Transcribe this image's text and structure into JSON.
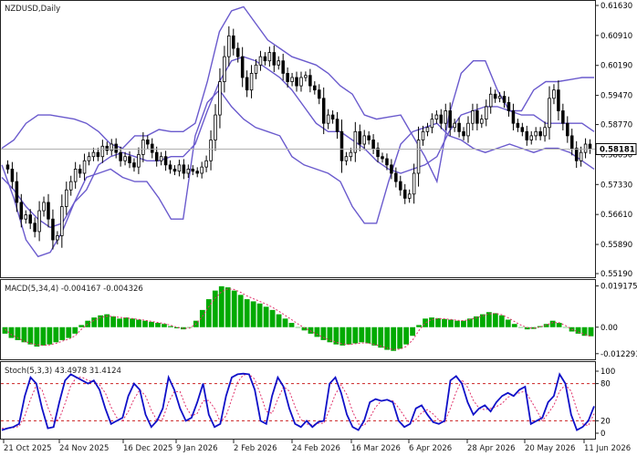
{
  "chart_data": [
    {
      "type": "candlestick",
      "title": "NZDUSD,Daily",
      "current_price": "0.58181",
      "y_ticks": [
        "0.61630",
        "0.60910",
        "0.60190",
        "0.59470",
        "0.58770",
        "0.58050",
        "0.57330",
        "0.56610",
        "0.55890",
        "0.55190"
      ],
      "x_ticks": [
        "21 Oct 2025",
        "24 Nov 2025",
        "16 Dec 2025",
        "9 Jan 2026",
        "2 Feb 2026",
        "24 Feb 2026",
        "16 Mar 2026",
        "6 Apr 2026",
        "28 Apr 2026",
        "20 May 2026",
        "11 Jun 2026"
      ],
      "ylim": [
        0.5519,
        0.6163
      ],
      "close_path": [
        0.577,
        0.574,
        0.569,
        0.565,
        0.566,
        0.564,
        0.562,
        0.567,
        0.569,
        0.565,
        0.56,
        0.561,
        0.568,
        0.572,
        0.574,
        0.577,
        0.576,
        0.579,
        0.58,
        0.581,
        0.58,
        0.5825,
        0.5815,
        0.583,
        0.581,
        0.579,
        0.58,
        0.5785,
        0.5775,
        0.5805,
        0.584,
        0.583,
        0.581,
        0.579,
        0.58,
        0.578,
        0.577,
        0.5765,
        0.578,
        0.576,
        0.577,
        0.5765,
        0.576,
        0.5775,
        0.579,
        0.584,
        0.59,
        0.598,
        0.604,
        0.609,
        0.606,
        0.604,
        0.599,
        0.596,
        0.6,
        0.602,
        0.604,
        0.603,
        0.605,
        0.602,
        0.603,
        0.6,
        0.598,
        0.599,
        0.597,
        0.599,
        0.5995,
        0.597,
        0.596,
        0.594,
        0.588,
        0.59,
        0.589,
        0.586,
        0.579,
        0.58,
        0.581,
        0.586,
        0.583,
        0.585,
        0.584,
        0.582,
        0.58,
        0.5795,
        0.578,
        0.576,
        0.574,
        0.572,
        0.57,
        0.571,
        0.576,
        0.584,
        0.586,
        0.587,
        0.589,
        0.59,
        0.588,
        0.591,
        0.587,
        0.588,
        0.586,
        0.585,
        0.588,
        0.591,
        0.588,
        0.589,
        0.592,
        0.595,
        0.594,
        0.5945,
        0.593,
        0.591,
        0.588,
        0.587,
        0.586,
        0.584,
        0.585,
        0.586,
        0.585,
        0.587,
        0.594,
        0.596,
        0.591,
        0.588,
        0.585,
        0.582,
        0.579,
        0.581,
        0.583,
        0.5818
      ],
      "bollinger_upper": [
        0.582,
        0.584,
        0.588,
        0.59,
        0.59,
        0.5895,
        0.589,
        0.588,
        0.586,
        0.583,
        0.582,
        0.585,
        0.585,
        0.5865,
        0.586,
        0.586,
        0.588,
        0.598,
        0.61,
        0.615,
        0.616,
        0.612,
        0.608,
        0.606,
        0.604,
        0.603,
        0.602,
        0.6,
        0.597,
        0.595,
        0.59,
        0.589,
        0.5895,
        0.59,
        0.585,
        0.58,
        0.574,
        0.59,
        0.6,
        0.603,
        0.603,
        0.596,
        0.591,
        0.591,
        0.596,
        0.598,
        0.598,
        0.5985,
        0.599,
        0.599
      ],
      "bollinger_middle": [
        0.575,
        0.572,
        0.568,
        0.565,
        0.563,
        0.564,
        0.569,
        0.572,
        0.578,
        0.58,
        0.581,
        0.58,
        0.579,
        0.579,
        0.58,
        0.58,
        0.583,
        0.591,
        0.598,
        0.603,
        0.604,
        0.603,
        0.601,
        0.599,
        0.596,
        0.592,
        0.588,
        0.586,
        0.586,
        0.584,
        0.582,
        0.579,
        0.577,
        0.576,
        0.577,
        0.578,
        0.58,
        0.586,
        0.59,
        0.591,
        0.592,
        0.592,
        0.591,
        0.59,
        0.59,
        0.588,
        0.588,
        0.588,
        0.588,
        0.586
      ],
      "bollinger_lower": [
        0.578,
        0.57,
        0.56,
        0.556,
        0.557,
        0.562,
        0.569,
        0.575,
        0.576,
        0.577,
        0.575,
        0.574,
        0.574,
        0.57,
        0.565,
        0.565,
        0.585,
        0.593,
        0.596,
        0.592,
        0.589,
        0.587,
        0.586,
        0.585,
        0.58,
        0.578,
        0.577,
        0.576,
        0.574,
        0.568,
        0.564,
        0.564,
        0.574,
        0.583,
        0.586,
        0.587,
        0.588,
        0.585,
        0.584,
        0.582,
        0.581,
        0.582,
        0.583,
        0.582,
        0.581,
        0.582,
        0.582,
        0.581,
        0.579,
        0.577
      ]
    },
    {
      "type": "bar",
      "title": "MACD(5,34,4) -0.004167 -0.004326",
      "y_ticks": [
        "0.019175",
        "0.00",
        "-0.012293"
      ],
      "ylim": [
        -0.0145,
        0.0215
      ],
      "values": [
        -0.003,
        -0.005,
        -0.006,
        -0.007,
        -0.008,
        -0.009,
        -0.0085,
        -0.008,
        -0.007,
        -0.006,
        -0.005,
        -0.003,
        0.001,
        0.003,
        0.0045,
        0.0055,
        0.006,
        0.005,
        0.004,
        0.0045,
        0.004,
        0.0035,
        0.003,
        0.0025,
        0.002,
        0.0015,
        0.0005,
        -0.0005,
        -0.001,
        0.0,
        0.003,
        0.008,
        0.013,
        0.017,
        0.019,
        0.0185,
        0.017,
        0.015,
        0.013,
        0.012,
        0.011,
        0.0095,
        0.008,
        0.006,
        0.004,
        0.002,
        0.0,
        -0.0015,
        -0.003,
        -0.0045,
        -0.006,
        -0.007,
        -0.008,
        -0.0085,
        -0.008,
        -0.0075,
        -0.007,
        -0.0075,
        -0.0085,
        -0.0095,
        -0.0105,
        -0.011,
        -0.01,
        -0.008,
        -0.004,
        0.001,
        0.004,
        0.0045,
        0.0042,
        0.0038,
        0.0035,
        0.003,
        0.003,
        0.004,
        0.005,
        0.006,
        0.007,
        0.0065,
        0.0055,
        0.0035,
        0.0015,
        0.0,
        -0.001,
        -0.0008,
        0.0005,
        0.0015,
        0.003,
        0.002,
        0.0,
        -0.002,
        -0.003,
        -0.004,
        -0.0042
      ],
      "signal": [
        -0.001,
        -0.0035,
        -0.005,
        -0.0065,
        -0.0075,
        -0.0082,
        -0.0085,
        -0.0082,
        -0.0075,
        -0.0065,
        -0.0055,
        -0.004,
        -0.001,
        0.0015,
        0.0032,
        0.0045,
        0.0052,
        0.005,
        0.0045,
        0.0043,
        0.004,
        0.0036,
        0.0032,
        0.0027,
        0.0022,
        0.0017,
        0.0009,
        0.0,
        -0.0006,
        -0.0004,
        0.0015,
        0.005,
        0.0095,
        0.0135,
        0.0165,
        0.0178,
        0.0175,
        0.0162,
        0.0145,
        0.0132,
        0.012,
        0.0107,
        0.0092,
        0.0074,
        0.0055,
        0.0035,
        0.0015,
        -0.0003,
        -0.0018,
        -0.0033,
        -0.0048,
        -0.006,
        -0.007,
        -0.0078,
        -0.008,
        -0.0077,
        -0.0073,
        -0.0074,
        -0.008,
        -0.0088,
        -0.0097,
        -0.0104,
        -0.0102,
        -0.009,
        -0.006,
        -0.0015,
        0.002,
        0.0035,
        0.004,
        0.0039,
        0.0036,
        0.0032,
        0.003,
        0.0036,
        0.0044,
        0.0053,
        0.0062,
        0.0064,
        0.0058,
        0.0044,
        0.0026,
        0.001,
        -0.0002,
        -0.0005,
        0.0001,
        0.001,
        0.0022,
        0.0021,
        0.0008,
        -0.001,
        -0.0022,
        -0.0033,
        -0.0043
      ]
    },
    {
      "type": "line",
      "title": "Stoch(5,3,3) 43.4978 31.4124",
      "y_ticks": [
        "100",
        "80",
        "20",
        "0"
      ],
      "ylim": [
        0,
        100
      ],
      "levels": [
        80,
        20
      ],
      "k_line": [
        5,
        8,
        10,
        15,
        60,
        90,
        80,
        40,
        8,
        10,
        50,
        85,
        95,
        90,
        85,
        80,
        85,
        70,
        40,
        15,
        20,
        25,
        60,
        80,
        70,
        30,
        10,
        20,
        40,
        90,
        70,
        40,
        20,
        25,
        50,
        80,
        30,
        10,
        15,
        60,
        90,
        95,
        96,
        95,
        70,
        20,
        15,
        60,
        90,
        75,
        40,
        15,
        10,
        20,
        10,
        18,
        20,
        80,
        90,
        65,
        30,
        10,
        5,
        20,
        50,
        55,
        52,
        54,
        50,
        20,
        10,
        15,
        40,
        45,
        30,
        18,
        15,
        20,
        85,
        92,
        80,
        50,
        30,
        40,
        45,
        35,
        50,
        60,
        65,
        60,
        70,
        75,
        15,
        20,
        25,
        50,
        60,
        95,
        80,
        30,
        5,
        10,
        20,
        43.5
      ],
      "d_line": [
        8,
        8,
        9,
        11,
        28,
        55,
        77,
        70,
        42,
        19,
        23,
        48,
        77,
        90,
        90,
        85,
        83,
        78,
        65,
        42,
        25,
        20,
        35,
        55,
        70,
        60,
        37,
        20,
        23,
        50,
        67,
        67,
        43,
        28,
        32,
        52,
        53,
        40,
        18,
        28,
        55,
        82,
        94,
        95,
        87,
        62,
        35,
        32,
        55,
        75,
        68,
        43,
        22,
        15,
        13,
        16,
        16,
        39,
        63,
        78,
        62,
        35,
        15,
        12,
        25,
        42,
        52,
        54,
        52,
        41,
        27,
        15,
        22,
        33,
        38,
        31,
        21,
        18,
        40,
        66,
        86,
        74,
        53,
        40,
        38,
        40,
        43,
        48,
        58,
        62,
        65,
        68,
        53,
        37,
        20,
        32,
        45,
        68,
        78,
        68,
        38,
        15,
        12,
        31.4
      ]
    }
  ]
}
